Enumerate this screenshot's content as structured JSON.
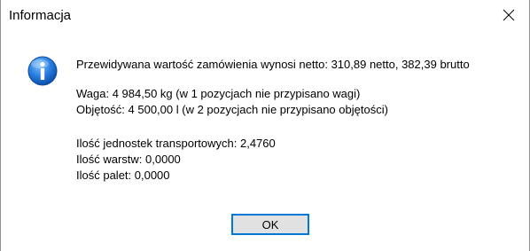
{
  "window": {
    "title": "Informacja"
  },
  "icons": {
    "info": "info-icon",
    "close": "close-icon"
  },
  "message": {
    "line1": "Przewidywana wartość zamówienia wynosi netto: 310,89 netto, 382,39 brutto",
    "line2": "Waga: 4 984,50 kg (w 1 pozycjach nie przypisano wagi)",
    "line3": "Objętość: 4 500,00 l (w 2 pozycjach nie przypisano objętości)",
    "line4": "Ilość jednostek transportowych: 2,4760",
    "line5": "Ilość warstw: 0,0000",
    "line6": "Ilość palet: 0,0000"
  },
  "buttons": {
    "ok": "OK"
  },
  "colors": {
    "accent": "#0078d7",
    "icon_blue": "#1f6fd0"
  }
}
